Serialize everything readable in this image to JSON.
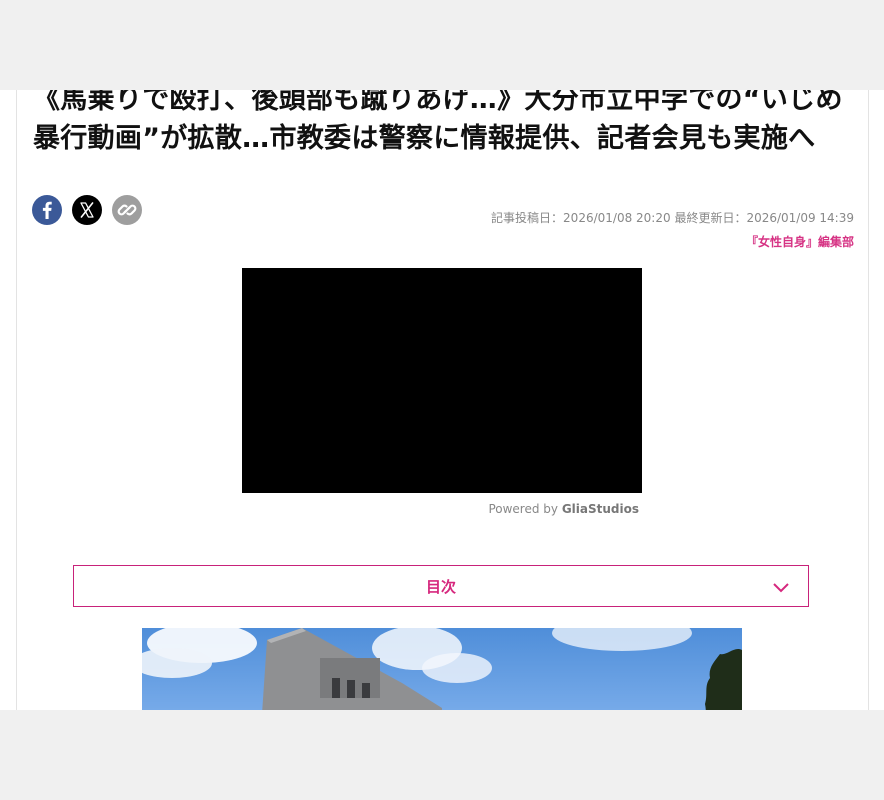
{
  "article": {
    "title": "《馬乗りで殴打、後頭部も蹴りあげ…》大分市立中学での“いじめ暴行動画”が拡散…市教委は警察に情報提供、記者会見も実施へ",
    "posted": "記事投稿日：2026/01/08 20:20",
    "updated": "最終更新日：2026/01/09 14:39",
    "editor": "『女性自身』編集部"
  },
  "share": {
    "icons": [
      "facebook-icon",
      "x-icon",
      "link-icon"
    ]
  },
  "video": {
    "powered_prefix": "Powered by ",
    "powered_brand": "GliaStudios"
  },
  "toc": {
    "label": "目次"
  },
  "colors": {
    "accent": "#d6287e",
    "facebook": "#3b5998",
    "x": "#000000",
    "link": "#9e9e9e"
  }
}
